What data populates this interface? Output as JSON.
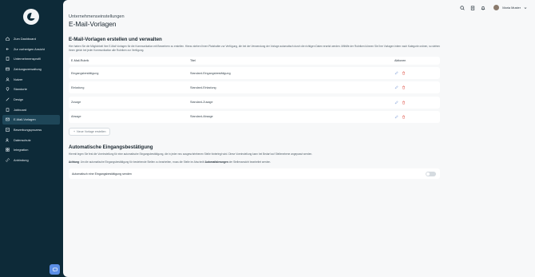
{
  "sidebar": {
    "items": [
      {
        "label": "Zum Dashboard",
        "icon": "home-icon"
      },
      {
        "label": "Zur vorherigen Ansicht",
        "icon": "arrow-left-icon"
      },
      {
        "label": "Unternehmensprofil",
        "icon": "building-icon"
      },
      {
        "label": "Zahlungsverwaltung",
        "icon": "credit-card-icon"
      },
      {
        "label": "Nutzer",
        "icon": "users-icon"
      },
      {
        "label": "Standorte",
        "icon": "location-pin-icon"
      },
      {
        "label": "Design",
        "icon": "brush-icon"
      },
      {
        "label": "Jobboard",
        "icon": "clipboard-icon"
      },
      {
        "label": "E-Mail-Vorlagen",
        "icon": "mail-icon"
      },
      {
        "label": "Bewerbungsprozess",
        "icon": "flow-icon"
      },
      {
        "label": "Datenschutz",
        "icon": "user-shield-icon"
      },
      {
        "label": "Integration",
        "icon": "grid-icon"
      },
      {
        "label": "Anbindung",
        "icon": "link-icon"
      }
    ]
  },
  "header": {
    "user_name": "Maria Muster",
    "subtitle": "Unternehmenseinstellungen",
    "title": "E-Mail-Vorlagen"
  },
  "templates_section": {
    "title": "E-Mail-Vorlagen erstellen und verwalten",
    "description": "Hier haben Sie die Möglichkeit Ihre E-Mail Vorlagen für die Kommunikation mit Bewerbern zu erstellen. Hierzu stehen Ihnen Platzhalter zur Verfügung, die bei der Verwendung der Vorlage automatisch durch die richtigen Daten ersetzt werden. Mithilfe der Rubriken können Sie Ihre Vorlagen intern nach Kategorie ordnen, so stehen Ihnen gleich bei jeder Kommunikation alle Rubriken zur Verfügung.",
    "columns": [
      "E-Mail-Rubrik",
      "Titel",
      "Aktionen"
    ],
    "rows": [
      {
        "rubrik": "Eingangsbestätigung",
        "titel": "Standard-Eingangsbestätigung"
      },
      {
        "rubrik": "Einladung",
        "titel": "Standard-Einladung"
      },
      {
        "rubrik": "Zusage",
        "titel": "Standard-Zusage"
      },
      {
        "rubrik": "Absage",
        "titel": "Standard-Absage"
      }
    ],
    "add_button": "Neue Vorlage erstellen"
  },
  "auto_section": {
    "title": "Automatische Eingangsbestätigung",
    "description1": "Hiermit legen Sie fest die Voreinstellung für eine automatische Eingangsbestätigung, die in jeder neu ausgeschriebenen Stelle hinterlegt wird. Diese Voreinstellung kann bei Bedarf auf Stellenebene angepasst werden.",
    "description2_bold1": "Achtung",
    "description2_mid": ": Um die automatische Eingangsbestätigung für bestehende Stellen zu bearbeiten, muss die Stelle im Abschnitt ",
    "description2_bold2": "Automatisierungen",
    "description2_end": " der Stellenansicht bearbeitet werden.",
    "toggle_label": "Automatisch eine Eingangsbestätigung senden",
    "toggle_on": false
  },
  "colors": {
    "sidebar": "#0d2a38",
    "accent": "#5b8ee6",
    "edit_icon": "#7a9bd6",
    "delete_icon": "#e05a4f"
  }
}
